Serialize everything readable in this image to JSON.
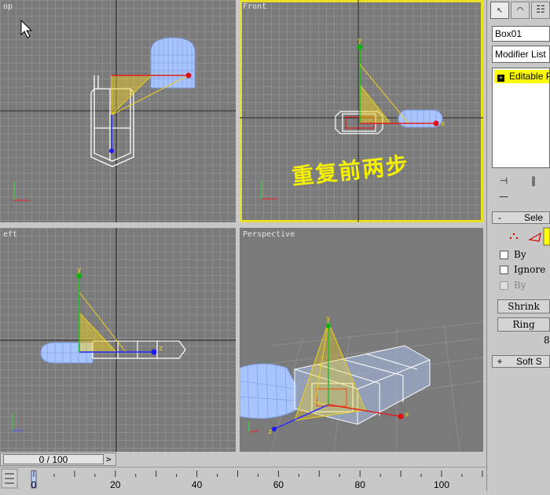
{
  "viewports": {
    "top": {
      "label": "op"
    },
    "front": {
      "label": "Front"
    },
    "left": {
      "label": "eft"
    },
    "perspective": {
      "label": "Perspective"
    }
  },
  "annotation": "重复前两步",
  "axis_labels": {
    "x": "x",
    "y": "y",
    "z": "z"
  },
  "command_panel": {
    "tabs": [
      "create",
      "modify",
      "hierarchy"
    ],
    "object_name": "Box01",
    "modifier_list": "Modifier List",
    "stack_item": "Editable P",
    "tools": [
      "pin-stack",
      "show-end-result"
    ],
    "selection_rollout": {
      "sign": "-",
      "title": "Sele",
      "checkboxes": [
        {
          "label": "By",
          "disabled": false
        },
        {
          "label": "Ignore",
          "disabled": false
        },
        {
          "label": "By",
          "disabled": true
        }
      ],
      "shrink_label": "Shrink",
      "ring_label": "Ring",
      "count": "8"
    },
    "soft_selection": {
      "sign": "+",
      "title": "Soft S"
    }
  },
  "timeline": {
    "frame_display": "0 / 100",
    "next": ">",
    "ticks": [
      "0",
      "20",
      "40",
      "60",
      "80",
      "100"
    ]
  },
  "colors": {
    "viewport_bg": "#7b7b7b",
    "active_border": "#e8e020",
    "gizmo_yellow": "#f0d020",
    "mesh_blue": "#a8c4ff",
    "annotation_yellow": "#f5f000"
  }
}
